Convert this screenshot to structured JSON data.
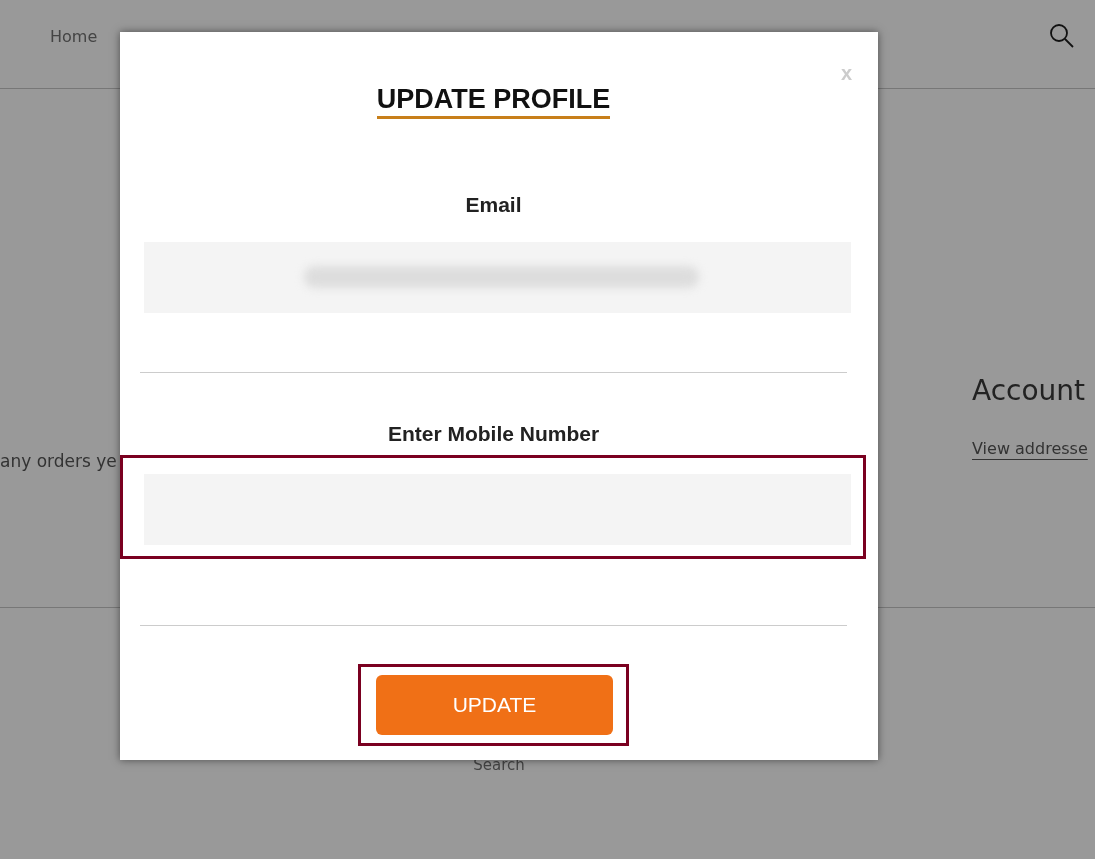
{
  "header": {
    "nav": [
      {
        "label": "Home"
      }
    ]
  },
  "page": {
    "orders_text": "any orders ye",
    "account": {
      "title": "Account",
      "link": "View addresse"
    },
    "footer_link": "Search"
  },
  "modal": {
    "title": "UPDATE PROFILE",
    "close": "x",
    "fields": [
      {
        "label": "Email",
        "blurred": true,
        "highlighted": false
      },
      {
        "label": "Enter Mobile Number",
        "blurred": false,
        "highlighted": true
      }
    ],
    "button": {
      "label": "UPDATE",
      "highlighted": true
    }
  }
}
